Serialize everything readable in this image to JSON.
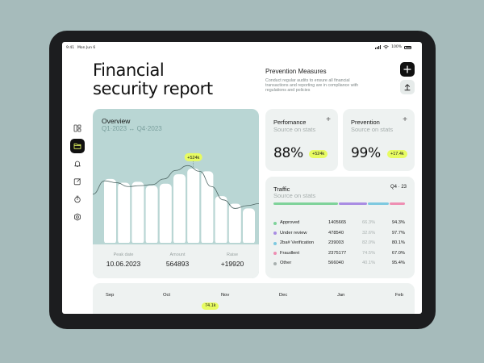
{
  "statusbar": {
    "time": "9:41",
    "date": "Mon Jun 6",
    "battery": "100%"
  },
  "header": {
    "title_line1": "Financial",
    "title_line2": "security report",
    "prevention": {
      "title": "Prevention Measures",
      "description": "Conduct regular audits to ensure all financial transactions and reporting are in compliance with regulations and policies"
    },
    "add_icon": "plus-icon",
    "upload_icon": "upload-icon"
  },
  "sidebar": {
    "items": [
      {
        "icon": "layout-icon",
        "active": false
      },
      {
        "icon": "folder-icon",
        "active": true
      },
      {
        "icon": "bell-icon",
        "active": false
      },
      {
        "icon": "edit-icon",
        "active": false
      },
      {
        "icon": "timer-icon",
        "active": false
      },
      {
        "icon": "gear-icon",
        "active": false
      }
    ]
  },
  "overview": {
    "title": "Overview",
    "subtitle": "Q1·2023 ↔ Q4·2023",
    "peak_badge": "+524k",
    "stats": [
      {
        "label": "Peak date",
        "value": "10.06.2023"
      },
      {
        "label": "Amount",
        "value": "564893"
      },
      {
        "label": "Raise",
        "value": "+19920"
      }
    ]
  },
  "chart_data": {
    "type": "bar",
    "values": [
      62,
      58,
      59,
      55,
      57,
      67,
      73,
      70,
      44,
      36,
      31
    ],
    "line": [
      46,
      60,
      58,
      54,
      55,
      56,
      62,
      71,
      76,
      70,
      54,
      40,
      31,
      34,
      36
    ],
    "ylim": [
      0,
      100
    ],
    "annotations": [
      "+524k"
    ]
  },
  "performance": {
    "title": "Perfomance",
    "subtitle": "Source on stats",
    "value": "88%",
    "badge": "+524k"
  },
  "prevention_kpi": {
    "title": "Prevention",
    "subtitle": "Source on stats",
    "value": "99%",
    "badge": "+17.4k"
  },
  "traffic": {
    "title": "Traffic",
    "subtitle": "Source on stats",
    "period": "Q4 · 23",
    "segments": [
      {
        "color": "#7fd39a",
        "share": 0.5
      },
      {
        "color": "#a98de3",
        "share": 0.22
      },
      {
        "color": "#7ec9e0",
        "share": 0.16
      },
      {
        "color": "#ee8fb3",
        "share": 0.12
      }
    ],
    "rows": [
      {
        "name": "Approved",
        "count": "1405665",
        "pct1": "66.3%",
        "pct2": "94.3%",
        "color": "#7fd39a"
      },
      {
        "name": "Under review",
        "count": "478540",
        "pct1": "32.6%",
        "pct2": "97.7%",
        "color": "#a98de3"
      },
      {
        "name": "2ba# Verification",
        "count": "239003",
        "pct1": "82.0%",
        "pct2": "80.1%",
        "color": "#7ec9e0"
      },
      {
        "name": "Fraudlent",
        "count": "2375177",
        "pct1": "74.5%",
        "pct2": "67.0%",
        "color": "#ee8fb3"
      },
      {
        "name": "Other",
        "count": "566040",
        "pct1": "40.1%",
        "pct2": "95.4%",
        "color": "#a8b0af"
      }
    ]
  },
  "timeline": {
    "months": [
      "Sep",
      "Oct",
      "Nov",
      "Dec",
      "Jan",
      "Feb"
    ],
    "badge": "74.1k"
  }
}
